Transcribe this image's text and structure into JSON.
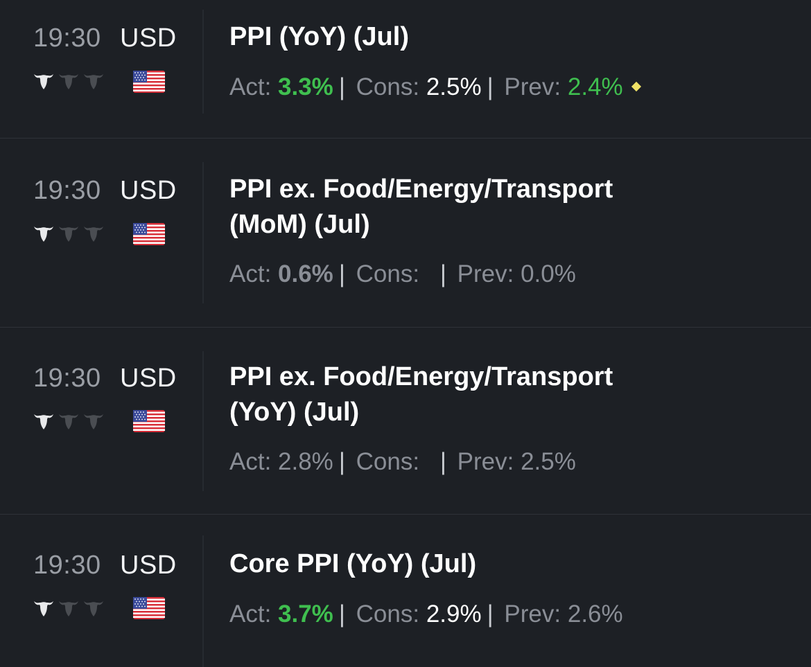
{
  "colors": {
    "background": "#1d2025",
    "green": "#3fbf4f",
    "label_grey": "#8a8e96",
    "white": "#ffffff",
    "diamond": "#f0e266"
  },
  "events": [
    {
      "time": "19:30",
      "currency": "USD",
      "importance": 1,
      "title": "PPI (YoY) (Jul)",
      "actual_label": "Act:",
      "actual": "3.3%",
      "consensus_label": "Cons:",
      "consensus": "2.5%",
      "previous_label": "Prev:",
      "previous": "2.4%",
      "revised_marker": true
    },
    {
      "time": "19:30",
      "currency": "USD",
      "importance": 1,
      "title": "PPI ex. Food/Energy/Transport\n(MoM) (Jul)",
      "actual_label": "Act:",
      "actual": "0.6%",
      "consensus_label": "Cons:",
      "consensus": "",
      "previous_label": "Prev:",
      "previous": "0.0%",
      "revised_marker": false
    },
    {
      "time": "19:30",
      "currency": "USD",
      "importance": 1,
      "title": "PPI ex. Food/Energy/Transport\n(YoY) (Jul)",
      "actual_label": "Act:",
      "actual": "2.8%",
      "consensus_label": "Cons:",
      "consensus": "",
      "previous_label": "Prev:",
      "previous": "2.5%",
      "revised_marker": false
    },
    {
      "time": "19:30",
      "currency": "USD",
      "importance": 1,
      "title": "Core PPI (YoY) (Jul)",
      "actual_label": "Act:",
      "actual": "3.7%",
      "consensus_label": "Cons:",
      "consensus": "2.9%",
      "previous_label": "Prev:",
      "previous": "2.6%",
      "revised_marker": false
    }
  ],
  "icons": {
    "importance": "bull-icon",
    "country": "us-flag-icon",
    "revised": "diamond-icon"
  }
}
